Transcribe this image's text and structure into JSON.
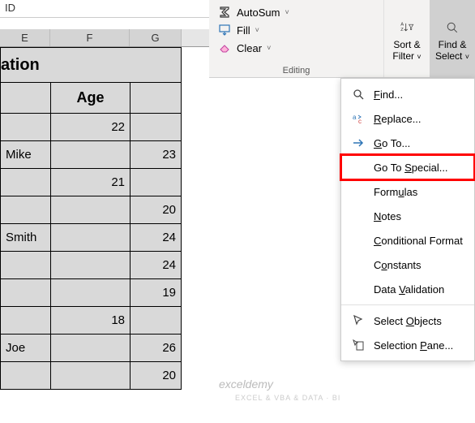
{
  "formula_bar": "ID",
  "columns": {
    "E": "E",
    "F": "F",
    "G": "G"
  },
  "ribbon": {
    "autosum": "AutoSum",
    "fill": "Fill",
    "clear": "Clear",
    "sort_filter_l1": "Sort &",
    "sort_filter_l2": "Filter",
    "find_select_l1": "Find &",
    "find_select_l2": "Select",
    "group_label": "Editing"
  },
  "table": {
    "title": "ation",
    "header": {
      "E": "",
      "F": "Age",
      "G": ""
    },
    "rows": [
      {
        "E": "",
        "F": "22",
        "G": ""
      },
      {
        "E": "Mike",
        "F": "",
        "G": "23"
      },
      {
        "E": "",
        "F": "21",
        "G": ""
      },
      {
        "E": "",
        "F": "",
        "G": "20"
      },
      {
        "E": "Smith",
        "F": "",
        "G": "24"
      },
      {
        "E": "",
        "F": "",
        "G": "24"
      },
      {
        "E": "",
        "F": "",
        "G": "19"
      },
      {
        "E": "",
        "F": "18",
        "G": ""
      },
      {
        "E": "Joe",
        "F": "",
        "G": "26"
      },
      {
        "E": "",
        "F": "",
        "G": "20"
      }
    ]
  },
  "menu": {
    "find": "Find...",
    "replace": "Replace...",
    "goto": "Go To...",
    "goto_special": "Go To Special...",
    "formulas": "Formulas",
    "notes": "Notes",
    "cond_format": "Conditional Format",
    "constants": "Constants",
    "data_validation": "Data Validation",
    "select_objects": "Select Objects",
    "selection_pane": "Selection Pane..."
  },
  "watermark": {
    "main": "exceldemy",
    "sub": "EXCEL & VBA & DATA · BI"
  }
}
